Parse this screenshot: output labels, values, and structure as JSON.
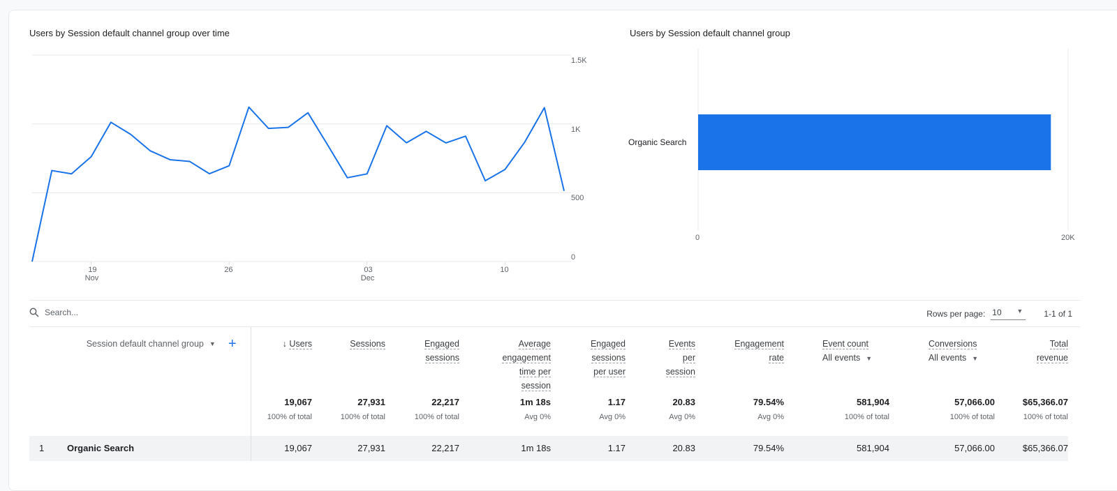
{
  "line_chart": {
    "title": "Users by Session default channel group over time",
    "y_ticks": [
      "0",
      "500",
      "1K",
      "1.5K"
    ],
    "y_tick_values": [
      0,
      500,
      1000,
      1500
    ],
    "x_ticks": [
      {
        "day": "19",
        "month": "Nov",
        "index": 3
      },
      {
        "day": "26",
        "month": "",
        "index": 10
      },
      {
        "day": "03",
        "month": "Dec",
        "index": 17
      },
      {
        "day": "10",
        "month": "",
        "index": 24
      }
    ],
    "color": "#1a73e8"
  },
  "bar_chart": {
    "title": "Users by Session default channel group",
    "x_ticks": [
      "0",
      "20K"
    ],
    "color": "#1a73e8"
  },
  "chart_data": [
    {
      "type": "line",
      "title": "Users by Session default channel group over time",
      "x": [
        "Nov 16",
        "Nov 17",
        "Nov 18",
        "Nov 19",
        "Nov 20",
        "Nov 21",
        "Nov 22",
        "Nov 23",
        "Nov 24",
        "Nov 25",
        "Nov 26",
        "Nov 27",
        "Nov 28",
        "Nov 29",
        "Nov 30",
        "Dec 01",
        "Dec 02",
        "Dec 03",
        "Dec 04",
        "Dec 05",
        "Dec 06",
        "Dec 07",
        "Dec 08",
        "Dec 09",
        "Dec 10",
        "Dec 11",
        "Dec 12",
        "Dec 13"
      ],
      "series": [
        {
          "values": [
            0,
            661,
            637,
            762,
            1012,
            924,
            804,
            740,
            727,
            638,
            696,
            1122,
            967,
            975,
            1081,
            847,
            609,
            637,
            987,
            863,
            946,
            862,
            911,
            587,
            669,
            867,
            1118,
            513
          ]
        }
      ],
      "ylim": [
        0,
        1500
      ],
      "grid": true,
      "y_axis_side": "right"
    },
    {
      "type": "bar",
      "orientation": "horizontal",
      "title": "Users by Session default channel group",
      "categories": [
        "Organic Search"
      ],
      "values": [
        19067
      ],
      "xlim": [
        0,
        20000
      ]
    }
  ],
  "table": {
    "search_placeholder": "Search...",
    "rows_per_page_label": "Rows per page:",
    "rows_per_page": "10",
    "range": "1-1 of 1",
    "dimension_header": "Session default channel group",
    "columns": [
      {
        "label": "Users",
        "sorted": "desc",
        "sort_icon": "↓"
      },
      {
        "label": "Sessions"
      },
      {
        "label": "Engaged sessions"
      },
      {
        "label": "Average engagement time per session"
      },
      {
        "label": "Engaged sessions per user"
      },
      {
        "label": "Events per session"
      },
      {
        "label": "Engagement rate"
      },
      {
        "label": "Event count",
        "filter": "All events"
      },
      {
        "label": "Conversions",
        "filter": "All events"
      },
      {
        "label": "Total revenue"
      }
    ],
    "totals": [
      "19,067",
      "27,931",
      "22,217",
      "1m 18s",
      "1.17",
      "20.83",
      "79.54%",
      "581,904",
      "57,066.00",
      "$65,366.07"
    ],
    "totals_sub": [
      "100% of total",
      "100% of total",
      "100% of total",
      "Avg 0%",
      "Avg 0%",
      "Avg 0%",
      "Avg 0%",
      "100% of total",
      "100% of total",
      "100% of total"
    ],
    "rows": [
      {
        "index": "1",
        "dimension": "Organic Search",
        "values": [
          "19,067",
          "27,931",
          "22,217",
          "1m 18s",
          "1.17",
          "20.83",
          "79.54%",
          "581,904",
          "57,066.00",
          "$65,366.07"
        ]
      }
    ]
  }
}
